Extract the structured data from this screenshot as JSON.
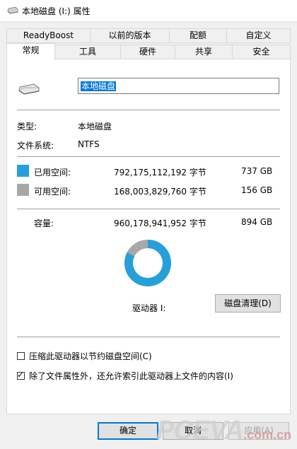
{
  "window": {
    "title": "本地磁盘 (I:) 属性"
  },
  "tabs_row1": [
    {
      "label": "ReadyBoost"
    },
    {
      "label": "以前的版本"
    },
    {
      "label": "配额"
    },
    {
      "label": "自定义"
    }
  ],
  "tabs_row2": [
    {
      "label": "常规",
      "active": true
    },
    {
      "label": "工具"
    },
    {
      "label": "硬件"
    },
    {
      "label": "共享"
    },
    {
      "label": "安全"
    }
  ],
  "general": {
    "drive_icon": "drive-icon",
    "name_value": "本地磁盘",
    "type_label": "类型:",
    "type_value": "本地磁盘",
    "fs_label": "文件系统:",
    "fs_value": "NTFS",
    "used": {
      "label": "已用空间:",
      "bytes": "792,175,112,192 字节",
      "size": "737 GB",
      "color": "#26a0da"
    },
    "free": {
      "label": "可用空间:",
      "bytes": "168,003,829,760 字节",
      "size": "156 GB",
      "color": "#a8a8a8"
    },
    "capacity": {
      "label": "容量:",
      "bytes": "960,178,941,952 字节",
      "size": "894 GB"
    },
    "used_fraction": 0.825,
    "drive_label": "驱动器 I:",
    "cleanup_button": "磁盘清理(D)",
    "compress_label": "压缩此驱动器以节约磁盘空间(C)",
    "compress_checked": false,
    "index_label": "除了文件属性外，还允许索引此驱动器上文件的内容(I)",
    "index_checked": true
  },
  "buttons": {
    "ok": "确定",
    "cancel": "取消",
    "apply": "应用(A)"
  },
  "watermark": {
    "main": "PCEVA",
    "sub": ".com.cn"
  }
}
